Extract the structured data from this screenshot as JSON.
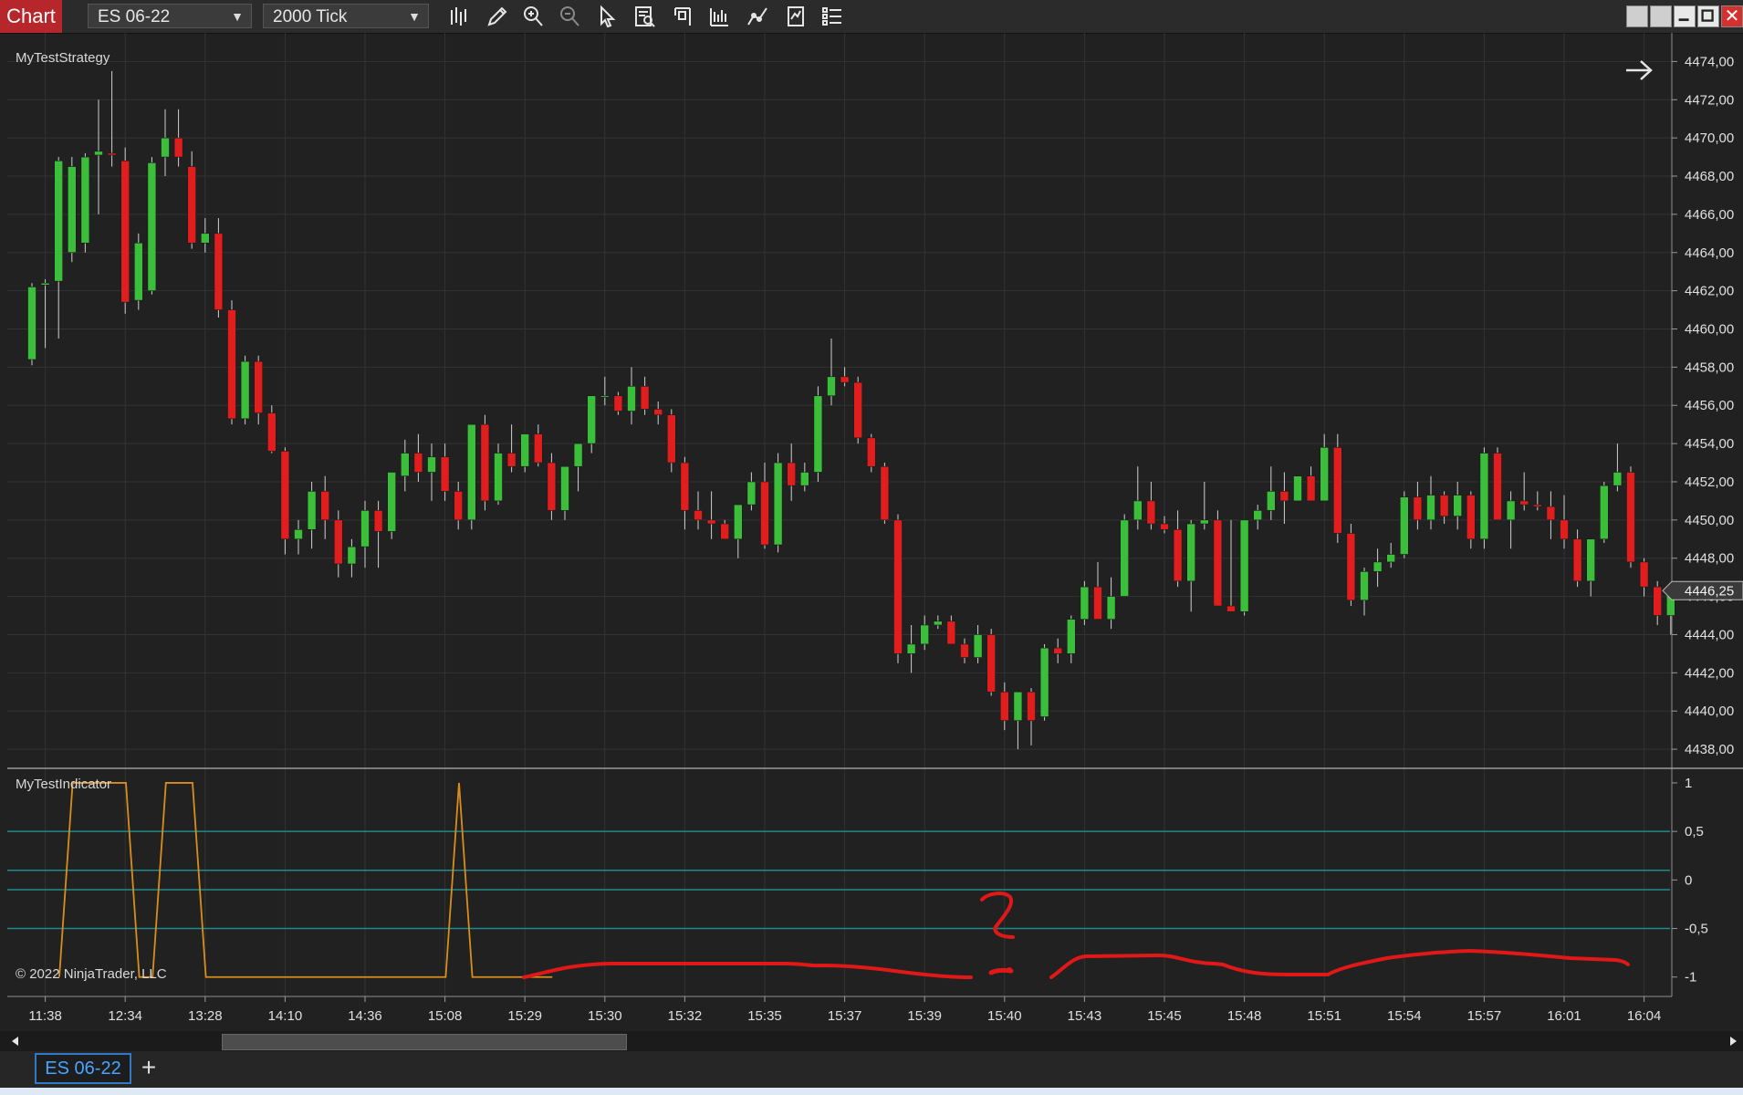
{
  "toolbar": {
    "badge": "Chart",
    "instrument": "ES 06-22",
    "interval": "2000 Tick"
  },
  "icons": [
    "bars-type-icon",
    "pencil-icon",
    "zoom-in-icon",
    "zoom-out-icon",
    "pointer-icon",
    "data-box-icon",
    "chart-trader-icon",
    "drawing-tools-icon",
    "indicators-icon",
    "strategy-icon",
    "properties-icon"
  ],
  "price_panel": {
    "label": "MyTestStrategy",
    "last_price": "4446,25",
    "up_color": "#3bbf3b",
    "down_color": "#e01e1e"
  },
  "indicator_panel": {
    "label": "MyTestIndicator",
    "copyright": "© 2022 NinjaTrader, LLC",
    "line_color": "#d98e1c",
    "level_color": "#1f8a8a"
  },
  "annotation": {
    "handwritten": "?",
    "color": "#e01818"
  },
  "tabs": [
    {
      "label": "ES 06-22",
      "active": true
    }
  ],
  "add_tab_label": "+",
  "chart_data": [
    {
      "type": "candlestick",
      "title": "",
      "y_axis": {
        "ylim": [
          4437,
          4475.5
        ],
        "ticks": [
          "4474,00",
          "4472,00",
          "4470,00",
          "4468,00",
          "4466,00",
          "4464,00",
          "4462,00",
          "4460,00",
          "4458,00",
          "4456,00",
          "4454,00",
          "4452,00",
          "4450,00",
          "4448,00",
          "4446,00",
          "4444,00",
          "4442,00",
          "4440,00",
          "4438,00"
        ],
        "tick_values": [
          4474,
          4472,
          4470,
          4468,
          4466,
          4464,
          4462,
          4460,
          4458,
          4456,
          4454,
          4452,
          4450,
          4448,
          4446,
          4444,
          4442,
          4440,
          4438
        ]
      },
      "x_axis": {
        "ticks": [
          "11:38",
          "12:34",
          "13:28",
          "14:10",
          "14:36",
          "15:08",
          "15:29",
          "15:30",
          "15:32",
          "15:35",
          "15:37",
          "15:39",
          "15:40",
          "15:43",
          "15:45",
          "15:48",
          "15:51",
          "15:54",
          "15:57",
          "16:01",
          "16:04"
        ],
        "tick_bar_index": [
          1,
          7,
          13,
          19,
          25,
          31,
          37,
          43,
          49,
          55,
          61,
          67,
          73,
          79,
          85,
          91,
          97,
          103,
          109,
          115,
          121
        ]
      },
      "grid": true,
      "ohlc": [
        [
          4458.4,
          4462.4,
          4458.1,
          4462.2
        ],
        [
          4462.3,
          4462.6,
          4459.0,
          4462.4
        ],
        [
          4462.5,
          4469.0,
          4459.5,
          4468.8
        ],
        [
          4464.0,
          4469.0,
          4463.5,
          4468.5
        ],
        [
          4464.5,
          4469.2,
          4464.0,
          4469.0
        ],
        [
          4469.1,
          4472.0,
          4466.0,
          4469.3
        ],
        [
          4469.2,
          4473.5,
          4468.5,
          4469.1
        ],
        [
          4468.8,
          4469.5,
          4460.8,
          4461.4
        ],
        [
          4461.5,
          4465.0,
          4461.0,
          4464.5
        ],
        [
          4462.0,
          4469.0,
          4461.8,
          4468.7
        ],
        [
          4469.0,
          4471.5,
          4468.0,
          4470.0
        ],
        [
          4470.0,
          4471.5,
          4468.5,
          4469.0
        ],
        [
          4468.5,
          4469.3,
          4464.2,
          4464.5
        ],
        [
          4464.5,
          4465.8,
          4464.0,
          4465.0
        ],
        [
          4465.0,
          4465.8,
          4460.6,
          4461.0
        ],
        [
          4461.0,
          4461.5,
          4455.0,
          4455.3
        ],
        [
          4455.3,
          4458.6,
          4455.0,
          4458.3
        ],
        [
          4458.3,
          4458.6,
          4455.0,
          4455.6
        ],
        [
          4455.6,
          4456.0,
          4453.5,
          4453.6
        ],
        [
          4453.6,
          4453.8,
          4448.2,
          4449.0
        ],
        [
          4449.0,
          4450.0,
          4448.2,
          4449.5
        ],
        [
          4449.5,
          4452.0,
          4448.5,
          4451.5
        ],
        [
          4451.5,
          4452.3,
          4449.0,
          4450.0
        ],
        [
          4450.0,
          4450.5,
          4447.0,
          4447.7
        ],
        [
          4447.7,
          4449.0,
          4447.0,
          4448.6
        ],
        [
          4448.6,
          4451.0,
          4447.5,
          4450.5
        ],
        [
          4450.5,
          4451.0,
          4447.5,
          4449.4
        ],
        [
          4449.4,
          4452.5,
          4449.0,
          4452.5
        ],
        [
          4452.3,
          4454.2,
          4451.5,
          4453.5
        ],
        [
          4453.5,
          4454.5,
          4452.0,
          4452.5
        ],
        [
          4452.5,
          4454.0,
          4451.0,
          4453.3
        ],
        [
          4453.3,
          4454.0,
          4451.0,
          4451.5
        ],
        [
          4451.5,
          4452.0,
          4449.5,
          4450.0
        ],
        [
          4450.0,
          4455.0,
          4449.5,
          4455.0
        ],
        [
          4455.0,
          4455.5,
          4450.5,
          4451.0
        ],
        [
          4451.0,
          4454.0,
          4450.8,
          4453.5
        ],
        [
          4453.5,
          4455.0,
          4452.5,
          4452.8
        ],
        [
          4452.8,
          4454.0,
          4452.5,
          4454.5
        ],
        [
          4454.5,
          4455.0,
          4452.8,
          4453.0
        ],
        [
          4453.0,
          4453.5,
          4450.0,
          4450.5
        ],
        [
          4450.5,
          4451.0,
          4450.0,
          4452.8
        ],
        [
          4452.8,
          4454.0,
          4451.5,
          4454.0
        ],
        [
          4454.0,
          4456.5,
          4453.5,
          4456.5
        ],
        [
          4456.5,
          4457.5,
          4456.0,
          4456.5
        ],
        [
          4456.5,
          4456.7,
          4455.5,
          4455.7
        ],
        [
          4455.7,
          4458.0,
          4455.0,
          4457.0
        ],
        [
          4457.0,
          4457.5,
          4455.5,
          4455.8
        ],
        [
          4455.8,
          4456.2,
          4455.0,
          4455.5
        ],
        [
          4455.5,
          4455.8,
          4452.5,
          4453.0
        ],
        [
          4453.0,
          4453.3,
          4449.5,
          4450.5
        ],
        [
          4450.5,
          4451.5,
          4449.5,
          4450.0
        ],
        [
          4450.0,
          4451.5,
          4449.0,
          4449.8
        ],
        [
          4449.8,
          4450.0,
          4449.0,
          4449.0
        ],
        [
          4449.0,
          4450.5,
          4448.0,
          4450.8
        ],
        [
          4450.8,
          4452.5,
          4450.5,
          4452.0
        ],
        [
          4452.0,
          4453.0,
          4448.5,
          4448.7
        ],
        [
          4448.7,
          4453.5,
          4448.3,
          4453.0
        ],
        [
          4453.0,
          4454.0,
          4451.0,
          4451.8
        ],
        [
          4451.8,
          4453.0,
          4451.5,
          4452.5
        ],
        [
          4452.5,
          4457.0,
          4452.0,
          4456.5
        ],
        [
          4456.5,
          4459.5,
          4456.0,
          4457.5
        ],
        [
          4457.5,
          4458.0,
          4457.0,
          4457.2
        ],
        [
          4457.2,
          4457.5,
          4454.0,
          4454.3
        ],
        [
          4454.3,
          4454.5,
          4452.5,
          4452.8
        ],
        [
          4452.8,
          4453.0,
          4449.8,
          4450.0
        ],
        [
          4450.0,
          4450.3,
          4442.5,
          4443.0
        ],
        [
          4443.0,
          4444.5,
          4442.0,
          4443.5
        ],
        [
          4443.5,
          4445.0,
          4443.2,
          4444.5
        ],
        [
          4444.5,
          4445.0,
          4444.3,
          4444.7
        ],
        [
          4444.7,
          4445.0,
          4443.5,
          4443.5
        ],
        [
          4443.5,
          4443.8,
          4442.5,
          4442.8
        ],
        [
          4442.8,
          4444.5,
          4442.5,
          4444.0
        ],
        [
          4444.0,
          4444.3,
          4440.8,
          4441.0
        ],
        [
          4441.0,
          4441.5,
          4439.0,
          4439.5
        ],
        [
          4439.5,
          4441.0,
          4438.0,
          4441.0
        ],
        [
          4441.0,
          4441.2,
          4438.2,
          4439.5
        ],
        [
          4439.7,
          4443.5,
          4439.5,
          4443.3
        ],
        [
          4443.3,
          4443.8,
          4442.5,
          4443.0
        ],
        [
          4443.0,
          4445.0,
          4442.5,
          4444.8
        ],
        [
          4444.8,
          4446.8,
          4444.5,
          4446.5
        ],
        [
          4446.5,
          4447.8,
          4444.8,
          4444.8
        ],
        [
          4444.8,
          4447.0,
          4444.3,
          4446.0
        ],
        [
          4446.0,
          4450.3,
          4446.0,
          4450.0
        ],
        [
          4450.0,
          4452.8,
          4449.5,
          4451.0
        ],
        [
          4451.0,
          4452.0,
          4449.5,
          4449.8
        ],
        [
          4449.8,
          4450.2,
          4449.3,
          4449.5
        ],
        [
          4449.5,
          4450.5,
          4446.5,
          4446.8
        ],
        [
          4446.8,
          4450.0,
          4445.2,
          4449.8
        ],
        [
          4449.8,
          4452.0,
          4449.5,
          4450.0
        ],
        [
          4450.0,
          4450.5,
          4445.5,
          4445.5
        ],
        [
          4445.5,
          4450.0,
          4445.2,
          4445.2
        ],
        [
          4445.2,
          4450.0,
          4445.0,
          4450.0
        ],
        [
          4450.0,
          4450.8,
          4449.5,
          4450.5
        ],
        [
          4450.5,
          4452.8,
          4450.0,
          4451.5
        ],
        [
          4451.5,
          4452.5,
          4449.8,
          4451.0
        ],
        [
          4451.0,
          4452.3,
          4451.0,
          4452.3
        ],
        [
          4452.3,
          4452.8,
          4452.0,
          4451.0
        ],
        [
          4451.0,
          4454.5,
          4451.8,
          4453.8
        ],
        [
          4453.8,
          4454.5,
          4448.8,
          4449.3
        ],
        [
          4449.3,
          4449.8,
          4445.5,
          4445.8
        ],
        [
          4445.8,
          4447.5,
          4445.0,
          4447.3
        ],
        [
          4447.3,
          4448.5,
          4446.5,
          4447.8
        ],
        [
          4447.8,
          4448.8,
          4447.5,
          4448.2
        ],
        [
          4448.2,
          4451.5,
          4448.0,
          4451.2
        ],
        [
          4451.2,
          4452.0,
          4449.5,
          4450.0
        ],
        [
          4450.0,
          4452.3,
          4449.5,
          4451.3
        ],
        [
          4451.3,
          4451.5,
          4449.8,
          4450.2
        ],
        [
          4450.2,
          4452.0,
          4449.5,
          4451.3
        ],
        [
          4451.3,
          4451.5,
          4448.5,
          4449.0
        ],
        [
          4449.0,
          4453.8,
          4448.5,
          4453.5
        ],
        [
          4453.5,
          4453.8,
          4450.8,
          4450.0
        ],
        [
          4450.0,
          4451.5,
          4448.5,
          4451.0
        ],
        [
          4451.0,
          4452.5,
          4450.5,
          4450.8
        ],
        [
          4450.8,
          4451.5,
          4450.5,
          4450.7
        ],
        [
          4450.7,
          4451.5,
          4449.0,
          4450.0
        ],
        [
          4450.0,
          4451.3,
          4448.5,
          4449.0
        ],
        [
          4449.0,
          4449.5,
          4446.5,
          4446.8
        ],
        [
          4446.8,
          4449.0,
          4446.0,
          4449.0
        ],
        [
          4449.0,
          4452.0,
          4448.8,
          4451.8
        ],
        [
          4451.8,
          4454.0,
          4451.5,
          4452.5
        ],
        [
          4452.5,
          4452.8,
          4447.5,
          4447.8
        ],
        [
          4447.8,
          4448.0,
          4446.0,
          4446.5
        ],
        [
          4446.5,
          4446.8,
          4444.5,
          4445.0
        ],
        [
          4445.0,
          4446.5,
          4444.0,
          4446.3
        ]
      ]
    },
    {
      "type": "line",
      "title": "",
      "ylim": [
        -1.2,
        1.15
      ],
      "y_ticks": [
        "1",
        "0,5",
        "0",
        "-0,5",
        "-1"
      ],
      "y_tick_values": [
        1,
        0.5,
        0,
        -0.5,
        -1
      ],
      "levels": [
        0.5,
        0.1,
        -0.1,
        -0.5
      ],
      "series": [
        {
          "values": [
            -1,
            1,
            1,
            1,
            1,
            1,
            -1,
            -1,
            1,
            1,
            1,
            -1,
            -1,
            -1,
            -1,
            -1,
            -1,
            -1,
            -1,
            -1,
            -1,
            -1,
            -1,
            -1,
            -1,
            -1,
            -1,
            -1,
            -1,
            -1,
            1,
            -1,
            -1,
            -1,
            -1,
            -1,
            -1,
            -1
          ]
        }
      ]
    }
  ]
}
